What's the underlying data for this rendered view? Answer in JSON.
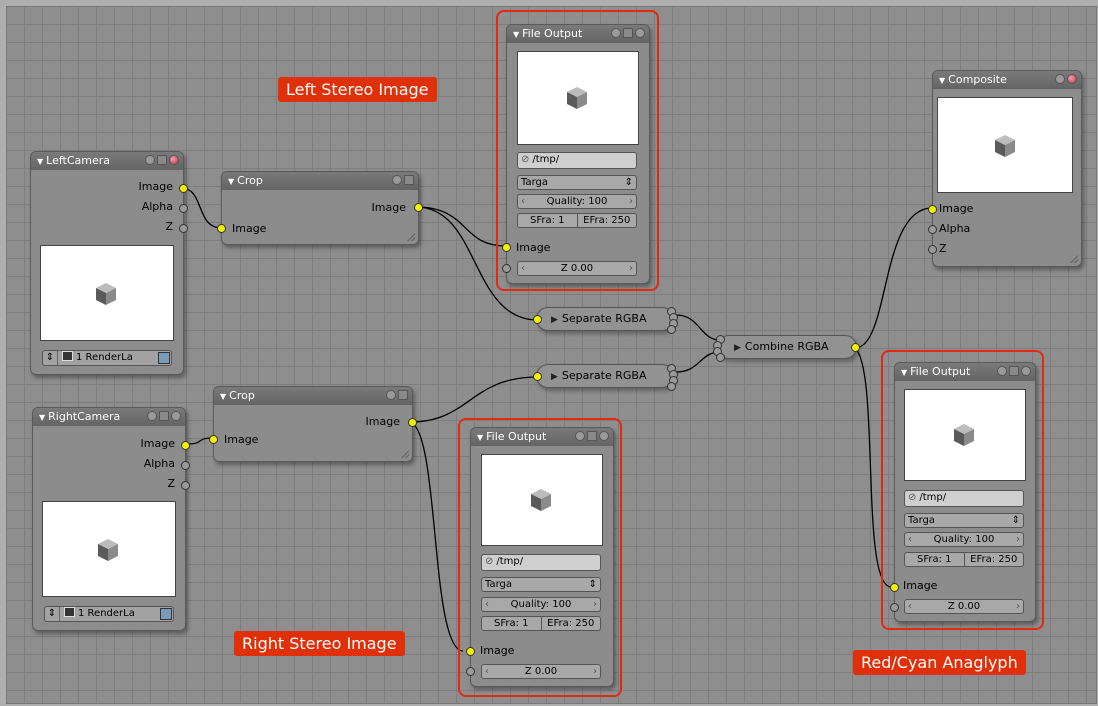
{
  "nodes": {
    "left_camera": {
      "title": "LeftCamera",
      "outputs": [
        "Image",
        "Alpha",
        "Z"
      ],
      "render_layer": "1 RenderLa"
    },
    "right_camera": {
      "title": "RightCamera",
      "outputs": [
        "Image",
        "Alpha",
        "Z"
      ],
      "render_layer": "1 RenderLa"
    },
    "crop_top": {
      "title": "Crop",
      "output": "Image",
      "input": "Image"
    },
    "crop_bottom": {
      "title": "Crop",
      "output": "Image",
      "input": "Image"
    },
    "file_output_left": {
      "title": "File Output",
      "path": "/tmp/",
      "format": "Targa",
      "quality": "Quality: 100",
      "sfra": "SFra: 1",
      "efra": "EFra: 250",
      "input": "Image",
      "z_value": "Z 0.00"
    },
    "file_output_right": {
      "title": "File Output",
      "path": "/tmp/",
      "format": "Targa",
      "quality": "Quality: 100",
      "sfra": "SFra: 1",
      "efra": "EFra: 250",
      "input": "Image",
      "z_value": "Z 0.00"
    },
    "file_output_anaglyph": {
      "title": "File Output",
      "path": "/tmp/",
      "format": "Targa",
      "quality": "Quality: 100",
      "sfra": "SFra: 1",
      "efra": "EFra: 250",
      "input": "Image",
      "z_value": "Z 0.00"
    },
    "composite": {
      "title": "Composite",
      "inputs": [
        "Image",
        "Alpha",
        "Z"
      ]
    },
    "separate_top": {
      "title": "Separate RGBA"
    },
    "separate_bottom": {
      "title": "Separate RGBA"
    },
    "combine": {
      "title": "Combine RGBA"
    }
  },
  "annotations": {
    "left": "Left Stereo Image",
    "right": "Right Stereo Image",
    "anaglyph": "Red/Cyan Anaglyph"
  },
  "colors": {
    "socket_image": "#f2f200",
    "socket_value": "#9a9a9a",
    "annotation": "#e0300a",
    "grid_bg": "#8e8e8e"
  }
}
